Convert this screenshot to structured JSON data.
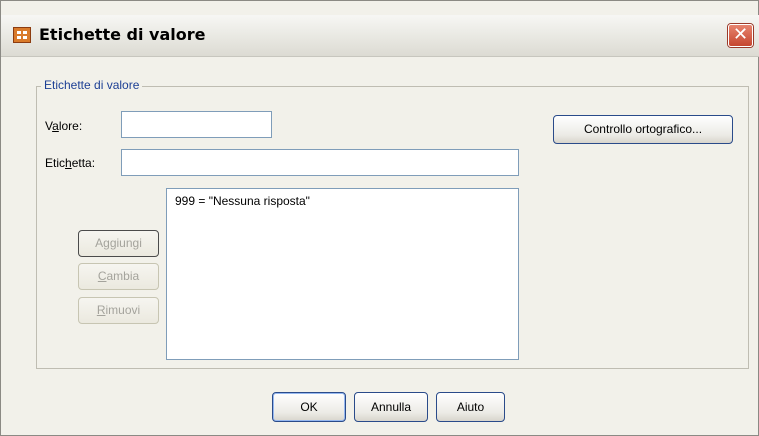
{
  "window": {
    "title": "Etichette di valore",
    "close_glyph": "✕"
  },
  "group": {
    "label": "Etichette di valore"
  },
  "fields": {
    "value": {
      "label_pre": "V",
      "label_ul": "a",
      "label_post": "lore:",
      "value": ""
    },
    "label": {
      "label_pre": "Etic",
      "label_ul": "h",
      "label_post": "etta:",
      "value": ""
    }
  },
  "list": {
    "items": [
      "999 = \"Nessuna risposta\""
    ]
  },
  "buttons": {
    "add": {
      "pre": "A",
      "ul": "g",
      "post": "giungi"
    },
    "change": {
      "pre": "",
      "ul": "C",
      "post": "ambia"
    },
    "remove": {
      "pre": "",
      "ul": "R",
      "post": "imuovi"
    },
    "spelling": "Controllo ortografico...",
    "ok": "OK",
    "cancel": "Annulla",
    "help": "Aiuto"
  },
  "colors": {
    "group_label": "#1c3f94",
    "dialog_bg": "#f2f1ea",
    "close_red": "#c5462f"
  }
}
